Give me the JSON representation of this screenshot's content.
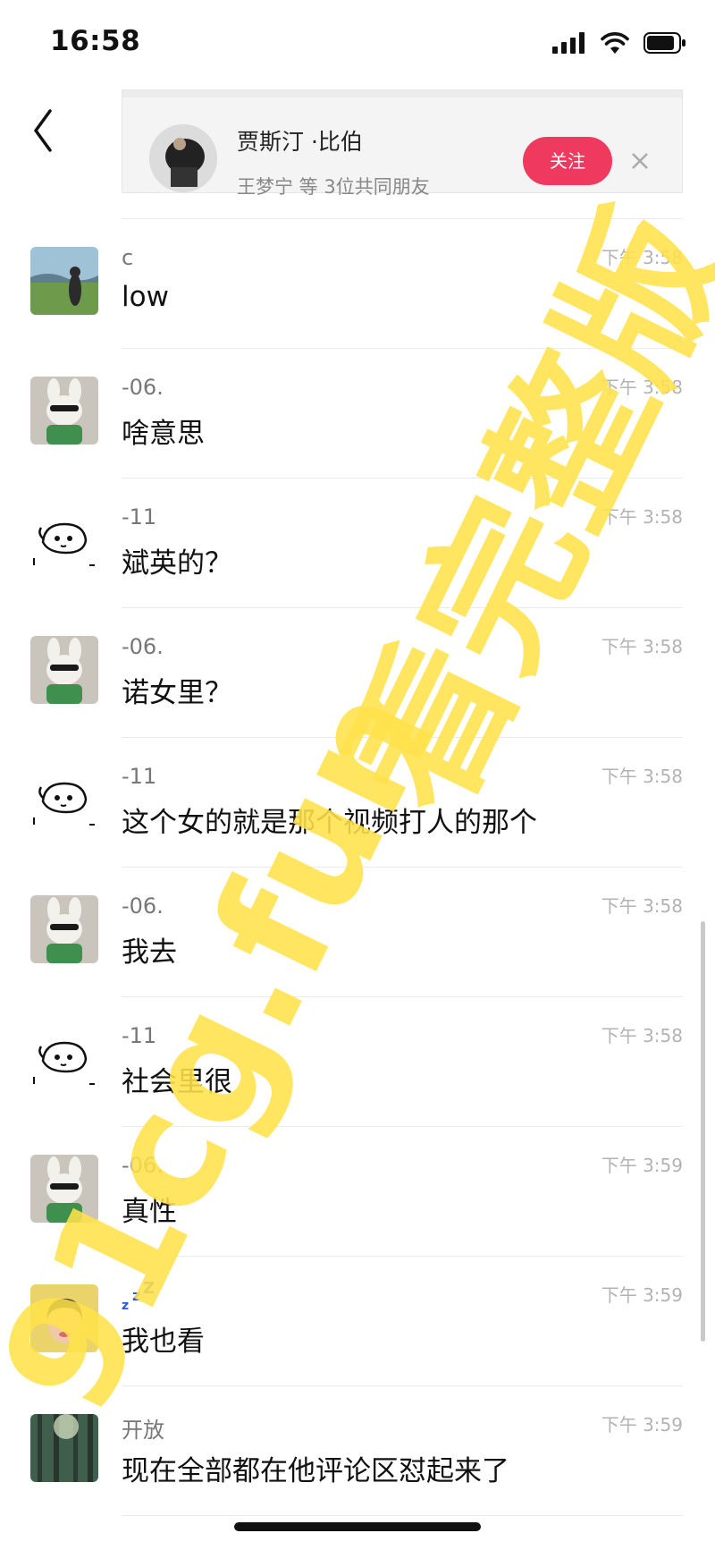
{
  "status_bar": {
    "time": "16:58"
  },
  "suggestion": {
    "name": "贾斯汀 ·比伯",
    "mutual_friends": "王梦宁 等 3位共同朋友",
    "follow_label": "关注"
  },
  "messages": [
    {
      "sender": "c",
      "time": "下午 3:58",
      "text": "low"
    },
    {
      "sender": "-06.",
      "time": "下午 3:58",
      "text": "啥意思"
    },
    {
      "sender": "-11",
      "time": "下午 3:58",
      "text": "斌英的？"
    },
    {
      "sender": "-06.",
      "time": "下午 3:58",
      "text": "诺女里？"
    },
    {
      "sender": "-11",
      "time": "下午 3:58",
      "text": "这个女的就是那个视频打人的那个"
    },
    {
      "sender": "-06.",
      "time": "下午 3:58",
      "text": "我去"
    },
    {
      "sender": "-11",
      "time": "下午 3:58",
      "text": "社会里很"
    },
    {
      "sender": "-06.",
      "time": "下午 3:59",
      "text": "真性"
    },
    {
      "sender": "",
      "time": "下午 3:59",
      "text": "我也看"
    },
    {
      "sender": "开放",
      "time": "下午 3:59",
      "text": "现在全部都在他评论区怼起来了"
    }
  ],
  "watermark": {
    "site": "91cg.fun",
    "tagline": "看完整版"
  },
  "colors": {
    "follow_button": "#f0395f",
    "watermark": "#ffe14a"
  },
  "icons": [
    "signal-icon",
    "wifi-icon",
    "battery-icon",
    "back-icon",
    "more-icon",
    "close-icon",
    "sleep-icon"
  ]
}
